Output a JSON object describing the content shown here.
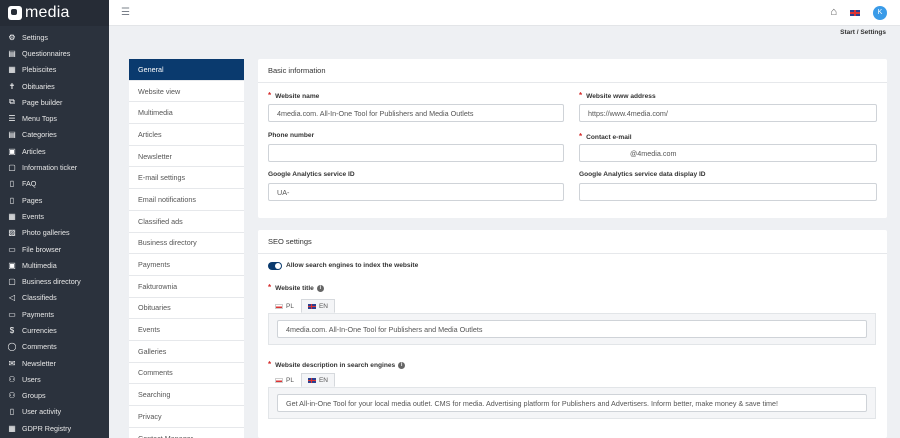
{
  "app": {
    "logo_text": "media"
  },
  "sidebar": {
    "items": [
      {
        "label": "Settings",
        "icon": "gear-icon",
        "glyph": "⚙"
      },
      {
        "label": "Questionnaires",
        "icon": "questionnaire-icon",
        "glyph": "▤"
      },
      {
        "label": "Plebiscites",
        "icon": "plebiscite-icon",
        "glyph": "▦"
      },
      {
        "label": "Obituaries",
        "icon": "obituary-icon",
        "glyph": "✝"
      },
      {
        "label": "Page builder",
        "icon": "page-builder-icon",
        "glyph": "⧉"
      },
      {
        "label": "Menu Tops",
        "icon": "menu-icon",
        "glyph": "☰"
      },
      {
        "label": "Categories",
        "icon": "categories-icon",
        "glyph": "▤"
      },
      {
        "label": "Articles",
        "icon": "articles-icon",
        "glyph": "▣"
      },
      {
        "label": "Information ticker",
        "icon": "ticker-icon",
        "glyph": "▢"
      },
      {
        "label": "FAQ",
        "icon": "faq-icon",
        "glyph": "▯"
      },
      {
        "label": "Pages",
        "icon": "pages-icon",
        "glyph": "▯"
      },
      {
        "label": "Events",
        "icon": "events-icon",
        "glyph": "▦"
      },
      {
        "label": "Photo galleries",
        "icon": "photo-gallery-icon",
        "glyph": "▨"
      },
      {
        "label": "File browser",
        "icon": "file-browser-icon",
        "glyph": "▭"
      },
      {
        "label": "Multimedia",
        "icon": "multimedia-icon",
        "glyph": "▣"
      },
      {
        "label": "Business directory",
        "icon": "business-directory-icon",
        "glyph": "▢"
      },
      {
        "label": "Classifieds",
        "icon": "classifieds-icon",
        "glyph": "◁"
      },
      {
        "label": "Payments",
        "icon": "payments-icon",
        "glyph": "▭"
      },
      {
        "label": "Currencies",
        "icon": "currencies-icon",
        "glyph": "$"
      },
      {
        "label": "Comments",
        "icon": "comments-icon",
        "glyph": "◯"
      },
      {
        "label": "Newsletter",
        "icon": "newsletter-icon",
        "glyph": "✉"
      },
      {
        "label": "Users",
        "icon": "users-icon",
        "glyph": "⚇"
      },
      {
        "label": "Groups",
        "icon": "groups-icon",
        "glyph": "⚇"
      },
      {
        "label": "User activity",
        "icon": "user-activity-icon",
        "glyph": "▯"
      },
      {
        "label": "GDPR Registry",
        "icon": "gdpr-icon",
        "glyph": "▦"
      }
    ]
  },
  "topbar": {
    "avatar_initial": "K",
    "home_icon": "home-icon",
    "language_flag": "uk-flag-icon"
  },
  "breadcrumb": "Start  /  Settings",
  "tabs": [
    {
      "label": "General",
      "active": true
    },
    {
      "label": "Website view"
    },
    {
      "label": "Multimedia"
    },
    {
      "label": "Articles"
    },
    {
      "label": "Newsletter"
    },
    {
      "label": "E-mail settings"
    },
    {
      "label": "Email notifications"
    },
    {
      "label": "Classified ads"
    },
    {
      "label": "Business directory"
    },
    {
      "label": "Payments"
    },
    {
      "label": "Fakturownia"
    },
    {
      "label": "Obituaries"
    },
    {
      "label": "Events"
    },
    {
      "label": "Galleries"
    },
    {
      "label": "Comments"
    },
    {
      "label": "Searching"
    },
    {
      "label": "Privacy"
    },
    {
      "label": "Contact Manager"
    }
  ],
  "basic": {
    "title": "Basic information",
    "website_name_label": "Website name",
    "website_name_value": "4media.com. All-In-One Tool for Publishers and Media Outlets",
    "website_address_label": "Website www address",
    "website_address_value": "https://www.4media.com/",
    "phone_label": "Phone number",
    "phone_value": "",
    "contact_email_label": "Contact e-mail",
    "contact_email_value": "@4media.com",
    "ga_id_label": "Google Analytics service ID",
    "ga_id_value": "UA-",
    "ga_display_label": "Google Analytics service data display ID",
    "ga_display_value": ""
  },
  "seo": {
    "title": "SEO settings",
    "index_toggle_label": "Allow search engines to index the website",
    "index_toggle_on": true,
    "website_title_label": "Website title",
    "website_title_langs": [
      "PL",
      "EN"
    ],
    "website_title_value": "4media.com. All-In-One Tool for Publishers and Media Outlets",
    "description_label": "Website description in search engines",
    "description_langs": [
      "PL",
      "EN"
    ],
    "description_value": "Get All-in-One Tool for your local media outlet. CMS for media. Advertising platform for Publishers and Advertisers. Inform better, make money & save time!"
  },
  "colors": {
    "sidebar_bg": "#2b323d",
    "active_tab": "#0a3a6e",
    "required_marker": "#d52b2b",
    "avatar": "#3a9be8"
  }
}
